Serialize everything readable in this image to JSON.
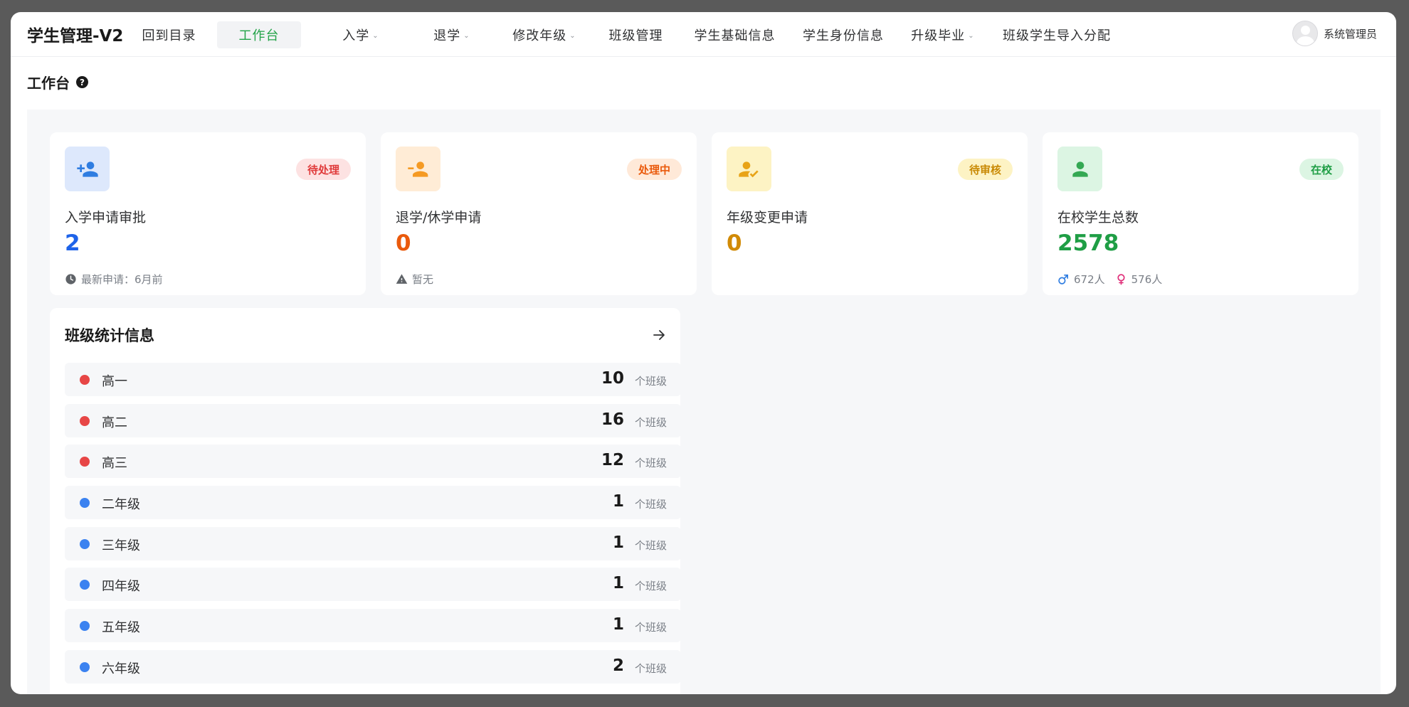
{
  "app": {
    "title": "学生管理-V2",
    "user": "系统管理员"
  },
  "nav": {
    "items": [
      {
        "label": "回到目录",
        "has_caret": false
      },
      {
        "label": "工作台",
        "has_caret": false,
        "active": true
      },
      {
        "label": "入学",
        "has_caret": true
      },
      {
        "label": "退学",
        "has_caret": true
      },
      {
        "label": "修改年级",
        "has_caret": true
      },
      {
        "label": "班级管理",
        "has_caret": false
      },
      {
        "label": "学生基础信息",
        "has_caret": false
      },
      {
        "label": "学生身份信息",
        "has_caret": false
      },
      {
        "label": "升级毕业",
        "has_caret": true
      },
      {
        "label": "班级学生导入分配",
        "has_caret": false
      }
    ],
    "caret_glyph": "⌄"
  },
  "page": {
    "title": "工作台",
    "help_glyph": "?"
  },
  "cards": [
    {
      "title": "入学申请审批",
      "value": "2",
      "value_color": "#1e63e9",
      "badge": "待处理",
      "badge_bg": "#fde2e2",
      "badge_color": "#e03b3b",
      "icon": "person-add-icon",
      "icon_bg": "#dde8fc",
      "icon_color": "#2f7de1",
      "foot_icon": "clock-icon",
      "foot_text": "最新申请：6月前"
    },
    {
      "title": "退学/休学申请",
      "value": "0",
      "value_color": "#ea5a0c",
      "badge": "处理中",
      "badge_bg": "#ffe9d8",
      "badge_color": "#ea5a0c",
      "icon": "person-remove-icon",
      "icon_bg": "#ffecd6",
      "icon_color": "#f59a23",
      "foot_icon": "warning-icon",
      "foot_text": "暂无"
    },
    {
      "title": "年级变更申请",
      "value": "0",
      "value_color": "#d18a06",
      "badge": "待审核",
      "badge_bg": "#fdf3c4",
      "badge_color": "#c98a05",
      "icon": "person-check-icon",
      "icon_bg": "#fdf3c4",
      "icon_color": "#e8a317",
      "foot_icon": "",
      "foot_text": ""
    },
    {
      "title": "在校学生总数",
      "value": "2578",
      "value_color": "#1f9e45",
      "badge": "在校",
      "badge_bg": "#dcf5e3",
      "badge_color": "#1f9e45",
      "icon": "person-icon",
      "icon_bg": "#dcf5e3",
      "icon_color": "#34a853",
      "foot_icon": "gender-icon",
      "foot_text": "",
      "male_text": "672人",
      "female_text": "576人"
    }
  ],
  "class_stats": {
    "title": "班级统计信息",
    "unit": "个班级",
    "rows": [
      {
        "label": "高一",
        "count": "10",
        "color": "#e74646"
      },
      {
        "label": "高二",
        "count": "16",
        "color": "#e74646"
      },
      {
        "label": "高三",
        "count": "12",
        "color": "#e74646"
      },
      {
        "label": "二年级",
        "count": "1",
        "color": "#3b82f0"
      },
      {
        "label": "三年级",
        "count": "1",
        "color": "#3b82f0"
      },
      {
        "label": "四年级",
        "count": "1",
        "color": "#3b82f0"
      },
      {
        "label": "五年级",
        "count": "1",
        "color": "#3b82f0"
      },
      {
        "label": "六年级",
        "count": "2",
        "color": "#3b82f0"
      }
    ]
  }
}
